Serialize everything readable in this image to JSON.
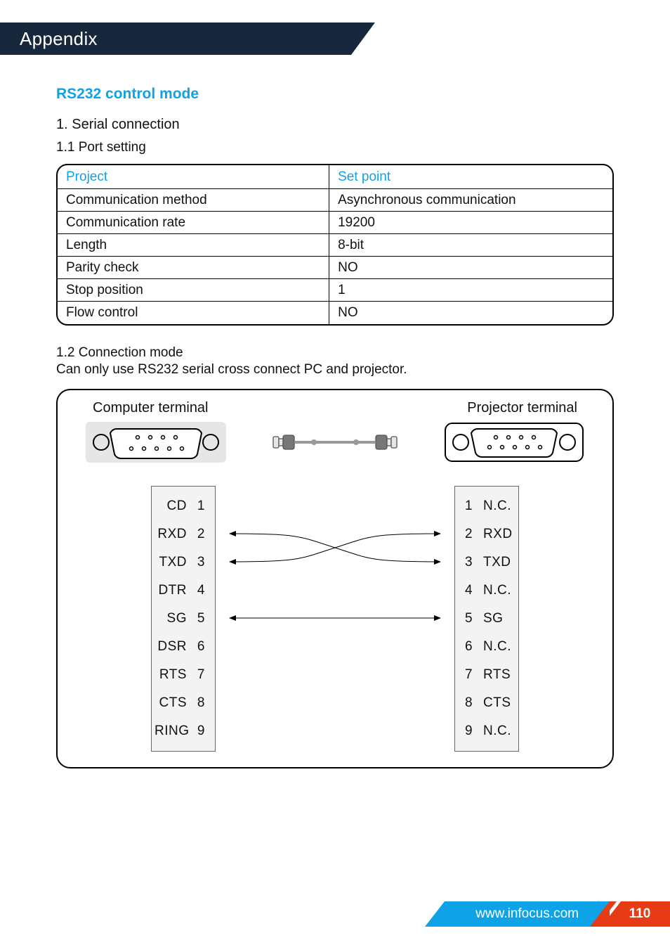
{
  "header": {
    "title": "Appendix"
  },
  "section": {
    "title": "RS232 control mode",
    "serial": {
      "title": "1. Serial connection",
      "port_setting_title": "1.1 Port setting",
      "table_headers": {
        "project": "Project",
        "setpoint": "Set point"
      },
      "rows": [
        {
          "project": "Communication method",
          "setpoint": "Asynchronous communication"
        },
        {
          "project": "Communication rate",
          "setpoint": "19200"
        },
        {
          "project": "Length",
          "setpoint": "8-bit"
        },
        {
          "project": "Parity check",
          "setpoint": "NO"
        },
        {
          "project": "Stop position",
          "setpoint": "1"
        },
        {
          "project": "Flow control",
          "setpoint": "NO"
        }
      ],
      "conn_mode_title": "1.2 Connection mode",
      "conn_mode_text": "Can only use RS232 serial cross connect PC and projector."
    }
  },
  "diagram": {
    "computer_label": "Computer terminal",
    "projector_label": "Projector terminal",
    "left_pins": [
      {
        "name": "CD",
        "num": "1"
      },
      {
        "name": "RXD",
        "num": "2"
      },
      {
        "name": "TXD",
        "num": "3"
      },
      {
        "name": "DTR",
        "num": "4"
      },
      {
        "name": "SG",
        "num": "5"
      },
      {
        "name": "DSR",
        "num": "6"
      },
      {
        "name": "RTS",
        "num": "7"
      },
      {
        "name": "CTS",
        "num": "8"
      },
      {
        "name": "RING",
        "num": "9"
      }
    ],
    "right_pins": [
      {
        "num": "1",
        "name": "N.C."
      },
      {
        "num": "2",
        "name": "RXD"
      },
      {
        "num": "3",
        "name": "TXD"
      },
      {
        "num": "4",
        "name": "N.C."
      },
      {
        "num": "5",
        "name": "SG"
      },
      {
        "num": "6",
        "name": "N.C."
      },
      {
        "num": "7",
        "name": "RTS"
      },
      {
        "num": "8",
        "name": "CTS"
      },
      {
        "num": "9",
        "name": "N.C."
      }
    ]
  },
  "footer": {
    "url": "www.infocus.com",
    "page": "110"
  }
}
